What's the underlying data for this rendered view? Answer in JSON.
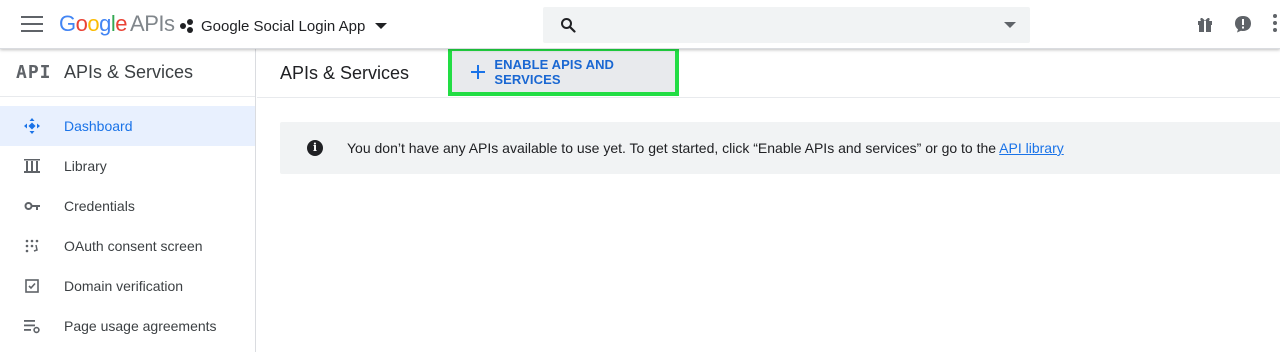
{
  "header": {
    "logo": {
      "google": "Google",
      "apis": "APIs"
    },
    "project_name": "Google Social Login App",
    "search": {
      "placeholder": ""
    }
  },
  "sidebar": {
    "logo_text": "API",
    "title": "APIs & Services",
    "items": [
      {
        "label": "Dashboard",
        "icon": "dashboard-icon",
        "active": true
      },
      {
        "label": "Library",
        "icon": "library-icon",
        "active": false
      },
      {
        "label": "Credentials",
        "icon": "key-icon",
        "active": false
      },
      {
        "label": "OAuth consent screen",
        "icon": "consent-grid-icon",
        "active": false
      },
      {
        "label": "Domain verification",
        "icon": "checkbox-icon",
        "active": false
      },
      {
        "label": "Page usage agreements",
        "icon": "list-settings-icon",
        "active": false
      }
    ]
  },
  "main": {
    "title": "APIs & Services",
    "enable_button_label": "ENABLE APIS AND SERVICES",
    "info": {
      "message": "You don’t have any APIs available to use yet. To get started, click “Enable APIs and services” or go to the ",
      "link": "API library"
    }
  },
  "colors": {
    "accent": "#1a73e8",
    "highlight_border": "#22dd44",
    "active_nav_bg": "#e8f0fe"
  }
}
